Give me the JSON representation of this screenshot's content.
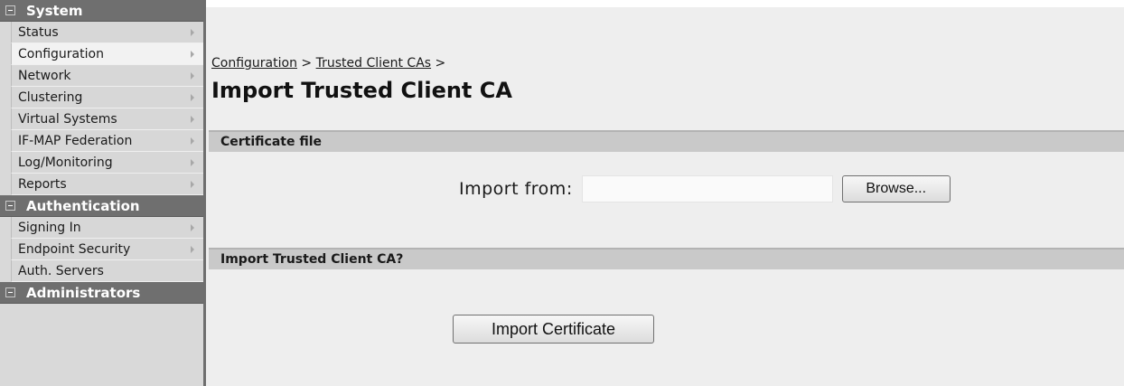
{
  "sidebar": {
    "sections": [
      {
        "title": "System",
        "items": [
          {
            "label": "Status"
          },
          {
            "label": "Configuration"
          },
          {
            "label": "Network"
          },
          {
            "label": "Clustering"
          },
          {
            "label": "Virtual Systems"
          },
          {
            "label": "IF-MAP Federation"
          },
          {
            "label": "Log/Monitoring"
          },
          {
            "label": "Reports"
          }
        ]
      },
      {
        "title": "Authentication",
        "items": [
          {
            "label": "Signing In"
          },
          {
            "label": "Endpoint Security"
          },
          {
            "label": "Auth. Servers"
          }
        ]
      },
      {
        "title": "Administrators",
        "items": []
      }
    ]
  },
  "breadcrumb": {
    "links": [
      "Configuration",
      "Trusted Client CAs"
    ],
    "separator": ">"
  },
  "page": {
    "title": "Import Trusted Client CA"
  },
  "certificate_section": {
    "title": "Certificate file",
    "import_label": "Import from:",
    "input_value": "",
    "browse_label": "Browse..."
  },
  "import_section": {
    "title": "Import Trusted Client CA?",
    "button_label": "Import Certificate"
  },
  "colors": {
    "sidebar_header": "#6f6f6f",
    "sidebar_bg": "#d9d9d9",
    "active_item": "#f2f2f2",
    "section_bar": "#c9c9c9",
    "main_bg": "#eeeeee"
  }
}
